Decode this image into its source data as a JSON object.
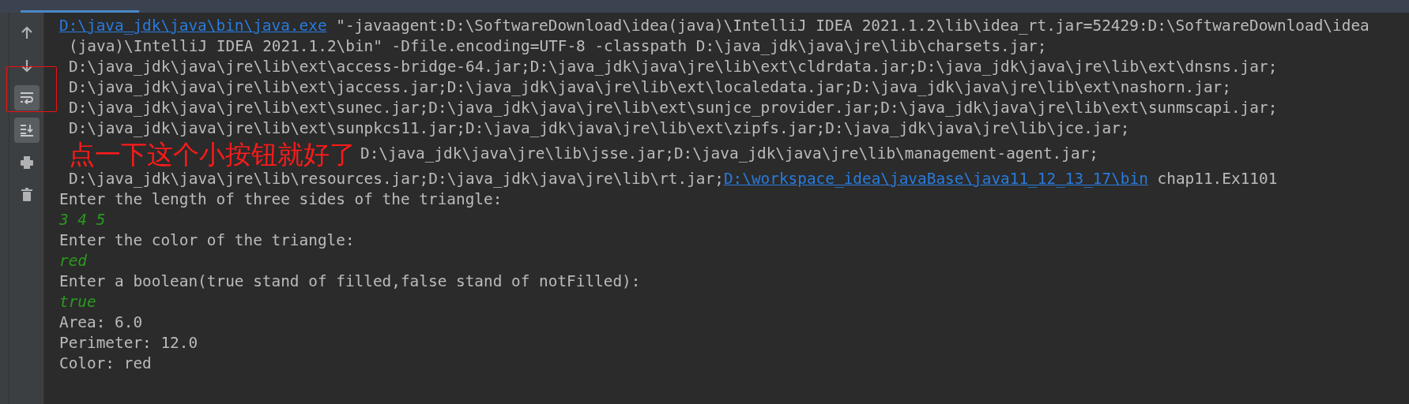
{
  "toolbar": [
    {
      "kind": "up",
      "selected": false
    },
    {
      "kind": "down",
      "selected": false
    },
    {
      "kind": "wrap",
      "selected": true
    },
    {
      "kind": "scroll-end",
      "selected": true
    },
    {
      "kind": "print",
      "selected": false
    },
    {
      "kind": "trash",
      "selected": false
    }
  ],
  "command_lines": [
    [
      {
        "kind": "link",
        "text": "D:\\java_jdk\\java\\bin\\java.exe"
      },
      {
        "kind": "plain",
        "text": " \"-javaagent:D:\\SoftwareDownload\\idea(java)\\IntelliJ IDEA 2021.1.2\\lib\\idea_rt.jar=52429:D:\\SoftwareDownload\\idea"
      }
    ],
    [
      {
        "kind": "plain",
        "text": "(java)\\IntelliJ IDEA 2021.1.2\\bin\" -Dfile.encoding=UTF-8 -classpath D:\\java_jdk\\java\\jre\\lib\\charsets.jar;"
      }
    ],
    [
      {
        "kind": "plain",
        "text": "D:\\java_jdk\\java\\jre\\lib\\ext\\access-bridge-64.jar;D:\\java_jdk\\java\\jre\\lib\\ext\\cldrdata.jar;D:\\java_jdk\\java\\jre\\lib\\ext\\dnsns.jar;"
      }
    ],
    [
      {
        "kind": "plain",
        "text": "D:\\java_jdk\\java\\jre\\lib\\ext\\jaccess.jar;D:\\java_jdk\\java\\jre\\lib\\ext\\localedata.jar;D:\\java_jdk\\java\\jre\\lib\\ext\\nashorn.jar;"
      }
    ],
    [
      {
        "kind": "plain",
        "text": "D:\\java_jdk\\java\\jre\\lib\\ext\\sunec.jar;D:\\java_jdk\\java\\jre\\lib\\ext\\sunjce_provider.jar;D:\\java_jdk\\java\\jre\\lib\\ext\\sunmscapi.jar;"
      }
    ],
    [
      {
        "kind": "plain",
        "text": "D:\\java_jdk\\java\\jre\\lib\\ext\\sunpkcs11.jar;D:\\java_jdk\\java\\jre\\lib\\ext\\zipfs.jar;D:\\java_jdk\\java\\jre\\lib\\jce.jar;"
      }
    ],
    [
      {
        "kind": "annotation",
        "text": "点一下这个小按钮就好了"
      },
      {
        "kind": "plain",
        "text": "D:\\java_jdk\\java\\jre\\lib\\jsse.jar;D:\\java_jdk\\java\\jre\\lib\\management-agent.jar;"
      }
    ],
    [
      {
        "kind": "plain",
        "text": "D:\\java_jdk\\java\\jre\\lib\\resources.jar;D:\\java_jdk\\java\\jre\\lib\\rt.jar;"
      },
      {
        "kind": "link",
        "text": "D:\\workspace_idea\\javaBase\\java11_12_13_17\\bin"
      },
      {
        "kind": "plain",
        "text": " chap11.Ex1101"
      }
    ]
  ],
  "output_lines": [
    {
      "kind": "output",
      "text": "Enter the length of three sides of the triangle:"
    },
    {
      "kind": "input",
      "text": "3 4 5"
    },
    {
      "kind": "output",
      "text": "Enter the color of the triangle:"
    },
    {
      "kind": "input",
      "text": "red"
    },
    {
      "kind": "output",
      "text": "Enter a boolean(true stand of filled,false stand of notFilled):"
    },
    {
      "kind": "input",
      "text": "true"
    },
    {
      "kind": "output",
      "text": "Area: 6.0"
    },
    {
      "kind": "output",
      "text": "Perimeter: 12.0"
    },
    {
      "kind": "output",
      "text": "Color: red"
    }
  ]
}
